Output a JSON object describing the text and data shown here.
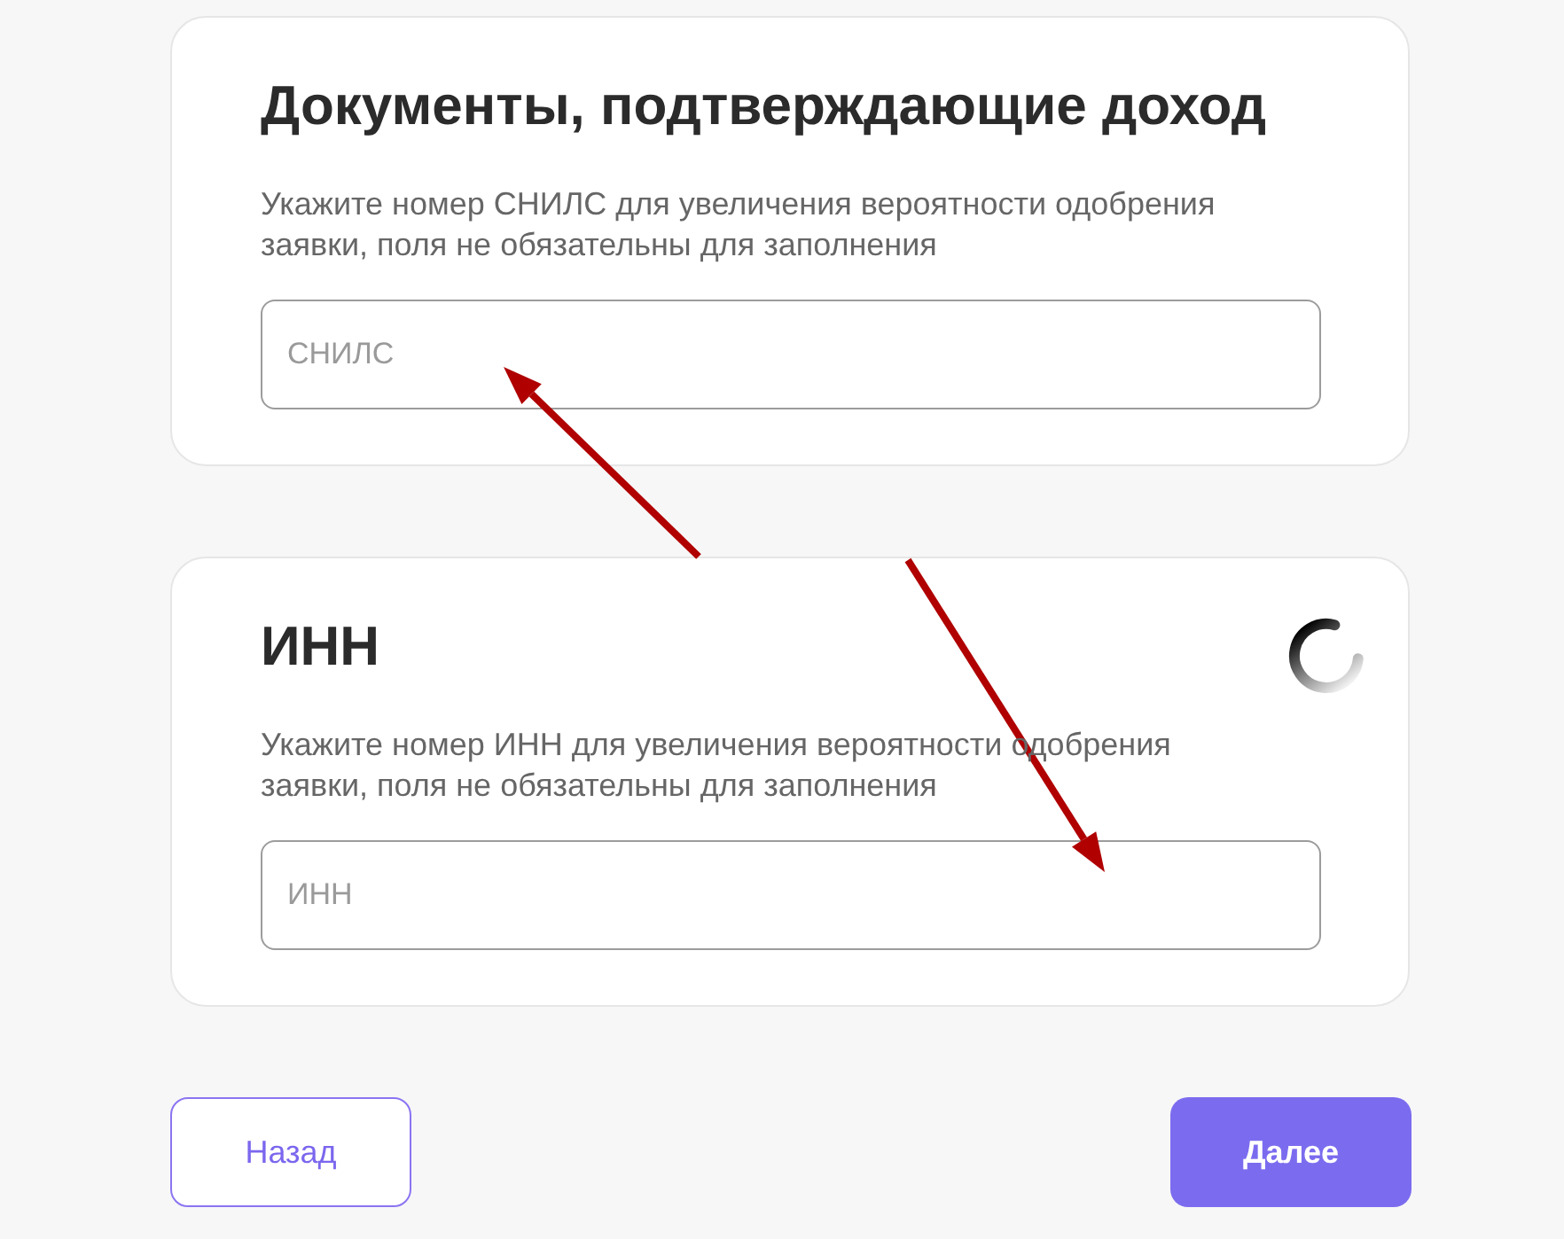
{
  "cards": [
    {
      "title": "Документы, подтверждающие доход",
      "description": "Укажите номер СНИЛС для увеличения вероятности одобрения\nзаявки, поля не обязательны для заполнения",
      "input": {
        "placeholder": "СНИЛС"
      },
      "loading": false
    },
    {
      "title": "ИНН",
      "description": "Укажите номер ИНН для увеличения вероятности одобрения\nзаявки, поля не обязательны для заполнения",
      "input": {
        "placeholder": "ИНН"
      },
      "loading": true
    }
  ],
  "buttons": [
    {
      "label": "Назад",
      "kind": "secondary"
    },
    {
      "label": "Далее",
      "kind": "primary"
    }
  ]
}
